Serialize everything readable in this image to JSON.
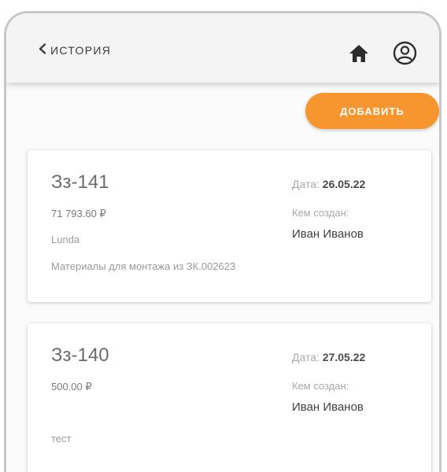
{
  "header": {
    "back_label": "ИСТОРИЯ",
    "icons": {
      "back": "chevron-left-icon",
      "home": "home-icon",
      "profile": "user-circle-icon"
    }
  },
  "actions": {
    "add_label": "ДОБАВИТЬ"
  },
  "colors": {
    "accent": "#f7962f",
    "header_bg": "#f4f4f4",
    "text_dark": "#3f3f3f"
  },
  "cards": [
    {
      "title": "Зз-141",
      "amount": "71 793.60 ₽",
      "org": "Lunda",
      "description": "Материалы для монтажа из ЗК.002623",
      "date_label": "Дата:",
      "date": "26.05.22",
      "created_label": "Кем создан:",
      "author": "Иван Иванов"
    },
    {
      "title": "Зз-140",
      "amount": "500.00 ₽",
      "org": "тест",
      "date_label": "Дата:",
      "date": "27.05.22",
      "created_label": "Кем создан:",
      "author": "Иван Иванов"
    }
  ]
}
